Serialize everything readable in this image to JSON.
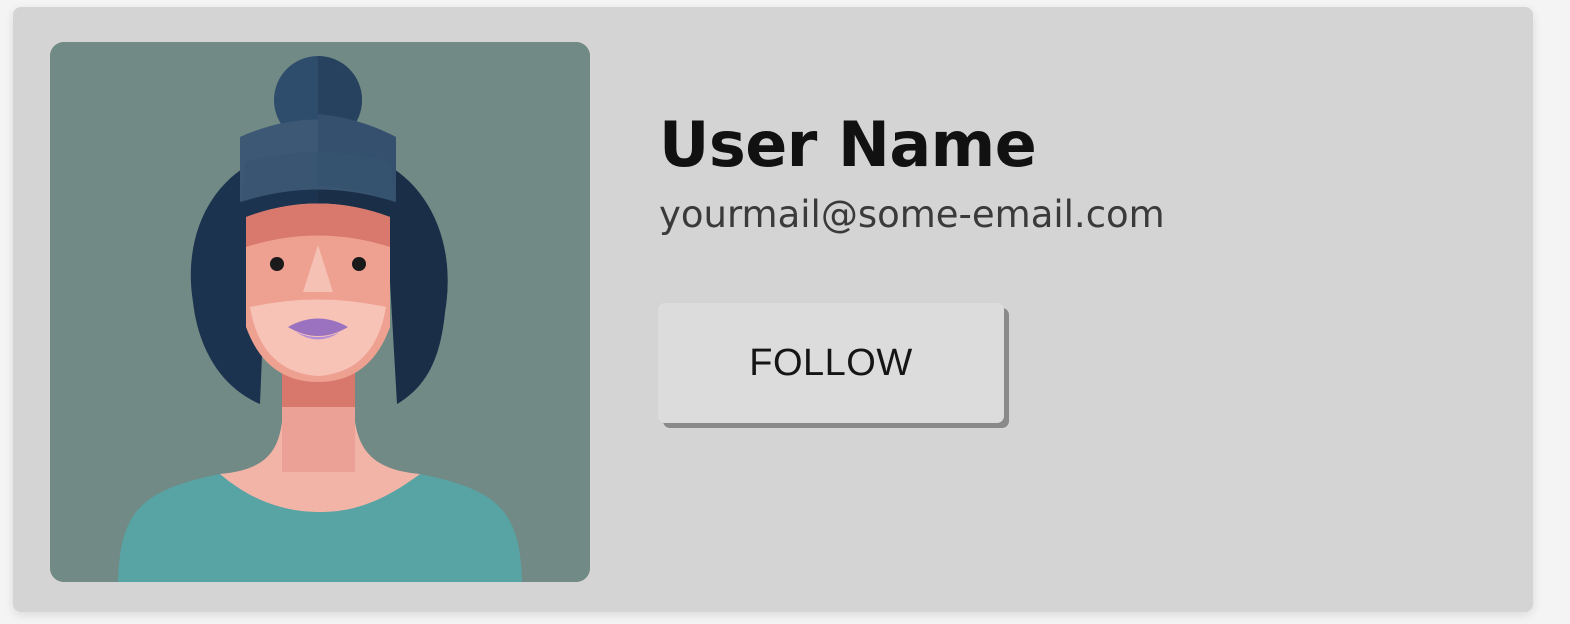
{
  "profile": {
    "name": "User Name",
    "email": "yourmail@some-email.com",
    "follow_label": "FOLLOW"
  },
  "avatar": {
    "icon": "woman-avatar-illustration"
  },
  "colors": {
    "card_background": "#d4d4d4",
    "avatar_background": "#728a85",
    "hair": "#1c3350",
    "skin": "#eea091",
    "shirt": "#58a3a3",
    "lips": "#9a72c0",
    "button_background": "#dcdcdc",
    "button_shadow": "#8a8a8a"
  }
}
